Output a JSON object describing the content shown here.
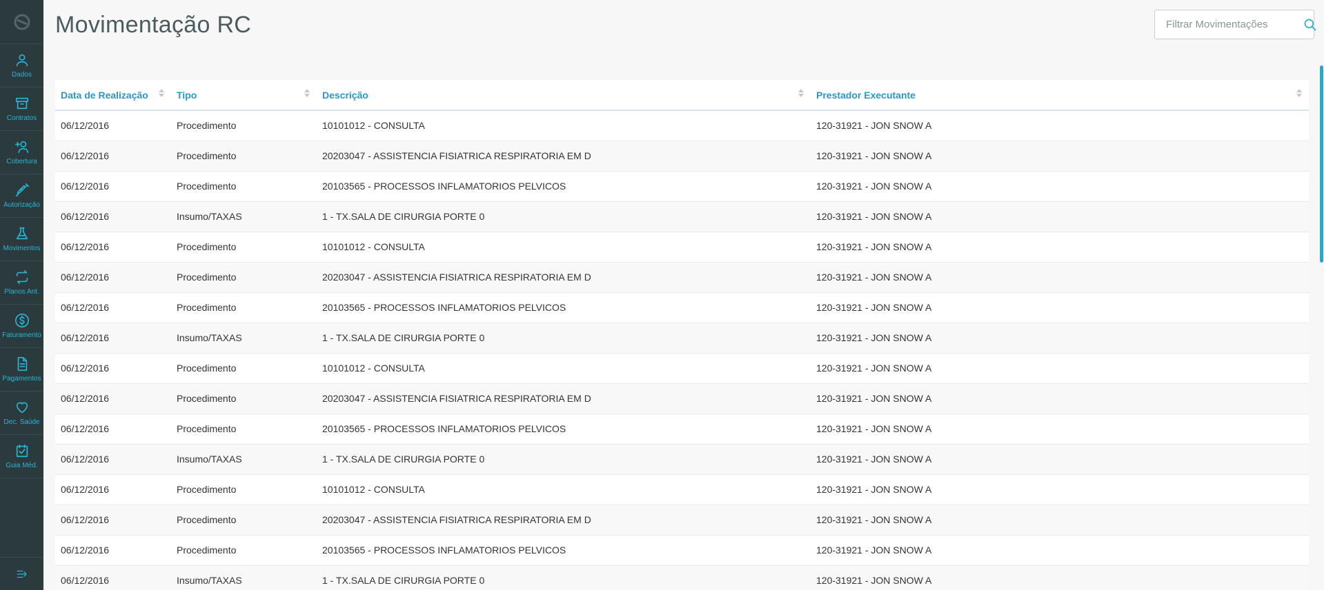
{
  "sidebar": {
    "items": [
      {
        "label": "Dados",
        "icon": "user-icon"
      },
      {
        "label": "Contratos",
        "icon": "archive-icon"
      },
      {
        "label": "Cobertura",
        "icon": "user-plus-icon"
      },
      {
        "label": "Autorização",
        "icon": "syringe-icon"
      },
      {
        "label": "Movimentos",
        "icon": "flask-icon"
      },
      {
        "label": "Planos Ant.",
        "icon": "refresh-icon"
      },
      {
        "label": "Faturamento",
        "icon": "dollar-icon"
      },
      {
        "label": "Pagamentos",
        "icon": "document-icon"
      },
      {
        "label": "Dec. Saúde",
        "icon": "heart-icon"
      },
      {
        "label": "Guia Méd.",
        "icon": "calendar-check-icon"
      }
    ]
  },
  "header": {
    "title": "Movimentação RC",
    "search_placeholder": "Filtrar Movimentações"
  },
  "table": {
    "columns": [
      "Data de Realização",
      "Tipo",
      "Descrição",
      "Prestador Executante"
    ],
    "rows": [
      [
        "06/12/2016",
        "Procedimento",
        "10101012 - CONSULTA",
        "120-31921 - JON SNOW A"
      ],
      [
        "06/12/2016",
        "Procedimento",
        "20203047 - ASSISTENCIA FISIATRICA RESPIRATORIA EM D",
        "120-31921 - JON SNOW A"
      ],
      [
        "06/12/2016",
        "Procedimento",
        "20103565 - PROCESSOS INFLAMATORIOS PELVICOS",
        "120-31921 - JON SNOW A"
      ],
      [
        "06/12/2016",
        "Insumo/TAXAS",
        "1 - TX.SALA DE CIRURGIA PORTE 0",
        "120-31921 - JON SNOW A"
      ],
      [
        "06/12/2016",
        "Procedimento",
        "10101012 - CONSULTA",
        "120-31921 - JON SNOW A"
      ],
      [
        "06/12/2016",
        "Procedimento",
        "20203047 - ASSISTENCIA FISIATRICA RESPIRATORIA EM D",
        "120-31921 - JON SNOW A"
      ],
      [
        "06/12/2016",
        "Procedimento",
        "20103565 - PROCESSOS INFLAMATORIOS PELVICOS",
        "120-31921 - JON SNOW A"
      ],
      [
        "06/12/2016",
        "Insumo/TAXAS",
        "1 - TX.SALA DE CIRURGIA PORTE 0",
        "120-31921 - JON SNOW A"
      ],
      [
        "06/12/2016",
        "Procedimento",
        "10101012 - CONSULTA",
        "120-31921 - JON SNOW A"
      ],
      [
        "06/12/2016",
        "Procedimento",
        "20203047 - ASSISTENCIA FISIATRICA RESPIRATORIA EM D",
        "120-31921 - JON SNOW A"
      ],
      [
        "06/12/2016",
        "Procedimento",
        "20103565 - PROCESSOS INFLAMATORIOS PELVICOS",
        "120-31921 - JON SNOW A"
      ],
      [
        "06/12/2016",
        "Insumo/TAXAS",
        "1 - TX.SALA DE CIRURGIA PORTE 0",
        "120-31921 - JON SNOW A"
      ],
      [
        "06/12/2016",
        "Procedimento",
        "10101012 - CONSULTA",
        "120-31921 - JON SNOW A"
      ],
      [
        "06/12/2016",
        "Procedimento",
        "20203047 - ASSISTENCIA FISIATRICA RESPIRATORIA EM D",
        "120-31921 - JON SNOW A"
      ],
      [
        "06/12/2016",
        "Procedimento",
        "20103565 - PROCESSOS INFLAMATORIOS PELVICOS",
        "120-31921 - JON SNOW A"
      ],
      [
        "06/12/2016",
        "Insumo/TAXAS",
        "1 - TX.SALA DE CIRURGIA PORTE 0",
        "120-31921 - JON SNOW A"
      ]
    ]
  },
  "colors": {
    "sidebar_bg": "#2b3a3c",
    "accent": "#29b6d8",
    "header_text": "#2998c8"
  }
}
